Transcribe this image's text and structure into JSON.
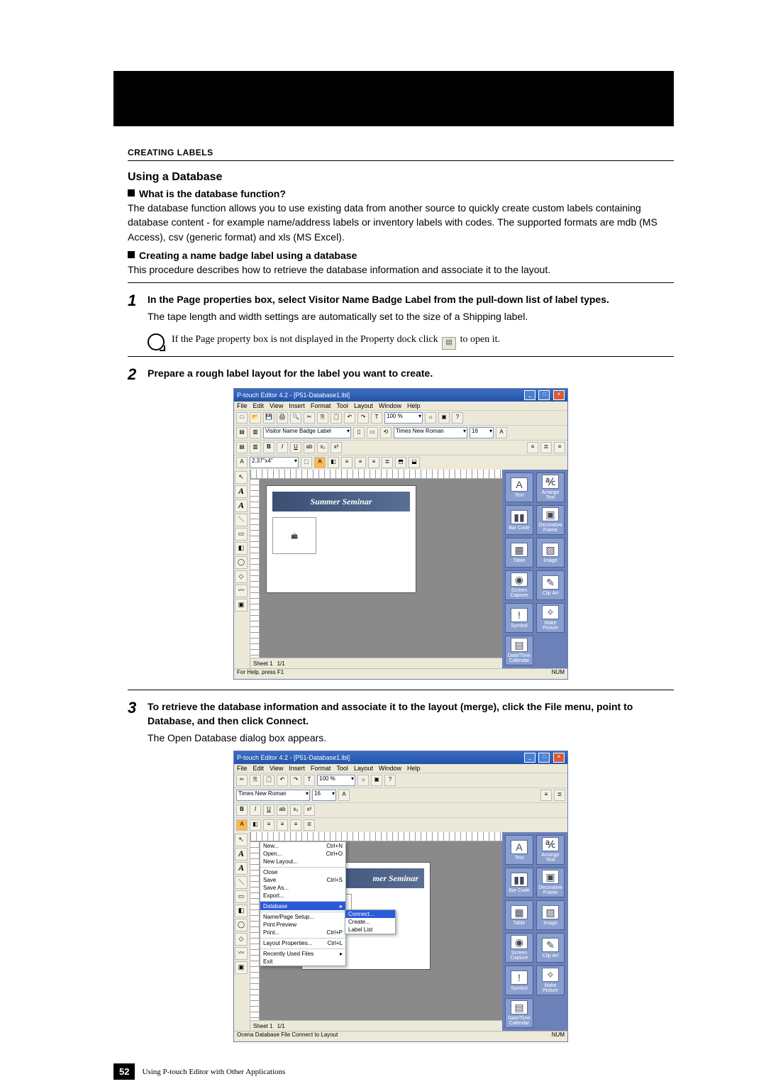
{
  "section_heading": "CREATING LABELS",
  "subtitle": "Using a Database",
  "block1": {
    "heading": "What is the database function?",
    "body": "The database function allows you to use existing data from another source to quickly create custom labels containing database content - for example name/address labels or inventory labels with codes. The supported formats are mdb (MS Access), csv (generic format) and xls (MS Excel)."
  },
  "block2": {
    "heading": "Creating a name badge label using a database",
    "body": "This procedure describes how to retrieve the database information and associate it to the layout."
  },
  "steps": {
    "s1": {
      "num": "1",
      "main": "In the Page properties box, select Visitor Name Badge Label from the pull-down list of label types.",
      "sub": "The tape length and width settings are automatically set to the size of a Shipping label."
    },
    "hint_pre": "If the Page property box is not displayed in the Property dock click ",
    "hint_post": " to open it.",
    "s2": {
      "num": "2",
      "main": "Prepare a rough label layout for the label you want to create."
    },
    "s3": {
      "num": "3",
      "main": "To retrieve the database information and associate it to the layout (merge), click the File menu, point to Database, and then click Connect.",
      "sub": "The Open Database dialog box appears."
    }
  },
  "screenshot": {
    "title": "P-touch Editor 4.2 - [P51-Database1.lbl]",
    "menus": [
      "File",
      "Edit",
      "View",
      "Insert",
      "Format",
      "Tool",
      "Layout",
      "Window",
      "Help"
    ],
    "label_type_combo": "Visitor Name Badge Label",
    "font_combo": "Times New Roman",
    "font_size_combo": "16",
    "zoom_combo": "100 %",
    "size_combo": "2.37\"x4\"",
    "card_banner": "Summer Seminar",
    "object_panel": [
      "Text",
      "Arrange Text",
      "Bar Code",
      "Decorative Frame",
      "Table",
      "Image",
      "Screen Capture",
      "Clip Art",
      "Symbol",
      "Make Picture",
      "Date/Time Calendar"
    ],
    "sheet_tab": "Sheet 1",
    "sheet_nav": "1/1",
    "status_left1": "For Help, press F1",
    "status_left2": "Ocena Database File Connect to Layout",
    "status_right": "NUM"
  },
  "file_menu": {
    "items": [
      {
        "label": "New...",
        "accel": "Ctrl+N"
      },
      {
        "label": "Open...",
        "accel": "Ctrl+O"
      },
      {
        "label": "New Layout..."
      },
      {
        "label": "Close"
      },
      {
        "label": "Save",
        "accel": "Ctrl+S"
      },
      {
        "label": "Save As..."
      },
      {
        "label": "Export..."
      },
      {
        "label": "Database",
        "hl": true,
        "arrow": true
      },
      {
        "label": "Name/Page Setup..."
      },
      {
        "label": "Print Preview"
      },
      {
        "label": "Print...",
        "accel": "Ctrl+P"
      },
      {
        "label": "Layout Properties...",
        "accel": "Ctrl+L"
      },
      {
        "label": "Recently Used Files",
        "arrow": true
      },
      {
        "label": "Exit"
      }
    ],
    "submenu": [
      {
        "label": "Connect...",
        "hl": true
      },
      {
        "label": "Create..."
      },
      {
        "label": "Label List"
      }
    ]
  },
  "card_banner2": "mer Seminar",
  "footer": {
    "page": "52",
    "caption": "Using P-touch Editor with Other Applications"
  }
}
